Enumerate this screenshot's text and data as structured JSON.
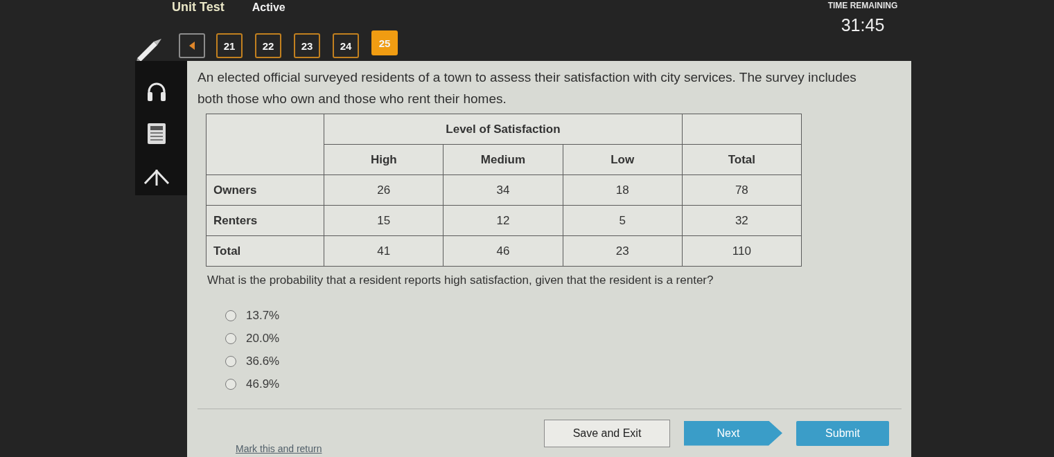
{
  "header": {
    "title": "Unit Test",
    "status": "Active",
    "timer_label": "TIME REMAINING",
    "timer": "31:45"
  },
  "question_nav": {
    "items": [
      {
        "label": "21",
        "selected": false
      },
      {
        "label": "22",
        "selected": false
      },
      {
        "label": "23",
        "selected": false
      },
      {
        "label": "24",
        "selected": false
      },
      {
        "label": "25",
        "selected": true
      }
    ]
  },
  "question": {
    "stem": "An elected official surveyed residents of a town to assess their satisfaction with city services. The survey includes both those who own and those who rent their homes.",
    "table": {
      "group_header": "Level of Satisfaction",
      "group_columns": [
        "High",
        "Medium",
        "Low"
      ],
      "other_columns": [
        "Total"
      ],
      "rows": [
        {
          "label": "Owners",
          "cells": [
            "26",
            "34",
            "18",
            "78"
          ]
        },
        {
          "label": "Renters",
          "cells": [
            "15",
            "12",
            "5",
            "32"
          ]
        },
        {
          "label": "Total",
          "cells": [
            "41",
            "46",
            "23",
            "110"
          ]
        }
      ]
    },
    "prompt": "What is the probability that a resident reports high satisfaction, given that the resident is a renter?",
    "options": [
      {
        "label": "13.7%",
        "selected": false
      },
      {
        "label": "20.0%",
        "selected": false
      },
      {
        "label": "36.6%",
        "selected": false
      },
      {
        "label": "46.9%",
        "selected": false
      }
    ]
  },
  "footer": {
    "mark_link": "Mark this and return",
    "buttons": [
      {
        "label": "Save and Exit",
        "kind": "secondary"
      },
      {
        "label": "Next",
        "kind": "next"
      },
      {
        "label": "Submit",
        "kind": "primary"
      }
    ]
  }
}
